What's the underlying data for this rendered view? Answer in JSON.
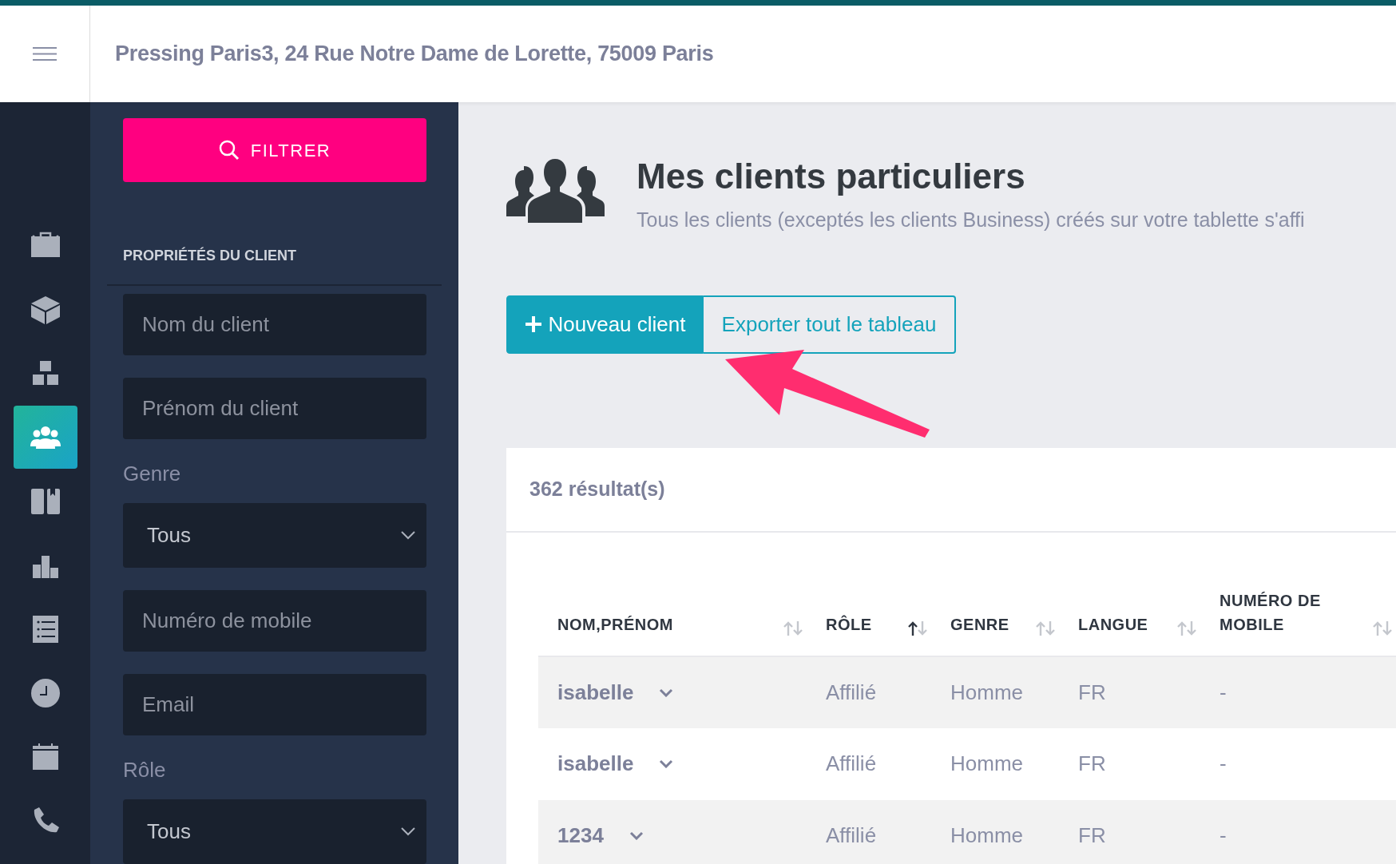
{
  "header": {
    "title": "Pressing Paris3, 24 Rue Notre Dame de Lorette, 75009 Paris"
  },
  "rail_items": [
    {
      "selected": false
    },
    {
      "selected": false
    },
    {
      "selected": false
    },
    {
      "selected": true
    },
    {
      "selected": false
    },
    {
      "selected": false
    },
    {
      "selected": false
    },
    {
      "selected": false
    },
    {
      "selected": false
    },
    {
      "selected": false
    }
  ],
  "filter_panel": {
    "button": "FILTRER",
    "section_title": "PROPRIÉTÉS DU CLIENT",
    "filters": [
      {
        "kind": "text",
        "placeholder": "Nom du client"
      },
      {
        "kind": "text",
        "placeholder": "Prénom du client"
      },
      {
        "kind": "select",
        "label": "Genre",
        "value": "Tous"
      },
      {
        "kind": "text",
        "placeholder": "Numéro de mobile"
      },
      {
        "kind": "text",
        "placeholder": "Email"
      },
      {
        "kind": "select",
        "label": "Rôle",
        "value": "Tous"
      }
    ]
  },
  "page": {
    "title": "Mes clients particuliers",
    "subtitle": "Tous les clients (exceptés les clients Business) créés sur votre tablette s'affi",
    "primary_button": "Nouveau client",
    "secondary_button": "Exporter tout le tableau"
  },
  "table": {
    "count": "362 résultat(s)",
    "columns": [
      {
        "label": "NOM,PRÉNOM",
        "sorted_ascending": false
      },
      {
        "label": "RÔLE",
        "sorted_ascending": true
      },
      {
        "label": "GENRE",
        "sorted_ascending": false
      },
      {
        "label": "LANGUE",
        "sorted_ascending": false
      },
      {
        "label": "NUMÉRO DE MOBILE",
        "sorted_ascending": false
      }
    ],
    "rows": [
      {
        "cells": [
          "isabelle",
          "Affilié",
          "Homme",
          "FR",
          "-"
        ]
      },
      {
        "cells": [
          "isabelle",
          "Affilié",
          "Homme",
          "FR",
          "-"
        ]
      },
      {
        "cells": [
          "1234",
          "Affilié",
          "Homme",
          "FR",
          "-"
        ]
      }
    ]
  }
}
